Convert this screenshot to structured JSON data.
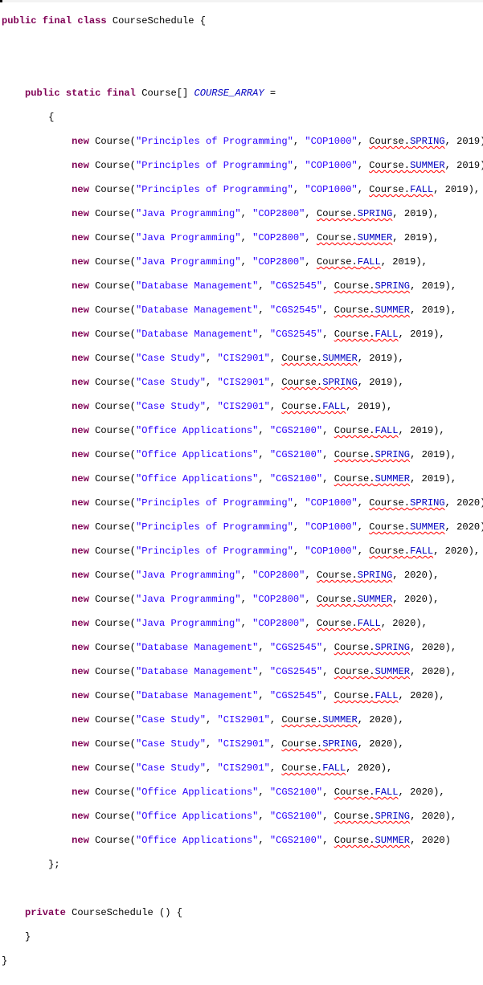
{
  "editor": {
    "class_decl": {
      "modifiers": "public final class",
      "name": "CourseSchedule",
      "open": " {"
    },
    "field_decl": {
      "modifiers": "public static final",
      "type": " Course[] ",
      "name": "COURSE_ARRAY",
      "assign": " ="
    },
    "array_open": "{",
    "array_close": "};",
    "new_keyword": "new",
    "ctor_name": " Course(",
    "enum_prefix": "Course.",
    "courses": [
      {
        "title": "\"Principles of Programming\"",
        "code": "\"COP1000\"",
        "term": "SPRING",
        "year": "2019",
        "tail": "),"
      },
      {
        "title": "\"Principles of Programming\"",
        "code": "\"COP1000\"",
        "term": "SUMMER",
        "year": "2019",
        "tail": "),"
      },
      {
        "title": "\"Principles of Programming\"",
        "code": "\"COP1000\"",
        "term": "FALL",
        "year": "2019",
        "tail": "),"
      },
      {
        "title": "\"Java Programming\"",
        "code": "\"COP2800\"",
        "term": "SPRING",
        "year": "2019",
        "tail": "),"
      },
      {
        "title": "\"Java Programming\"",
        "code": "\"COP2800\"",
        "term": "SUMMER",
        "year": "2019",
        "tail": "),"
      },
      {
        "title": "\"Java Programming\"",
        "code": "\"COP2800\"",
        "term": "FALL",
        "year": "2019",
        "tail": "),"
      },
      {
        "title": "\"Database Management\"",
        "code": "\"CGS2545\"",
        "term": "SPRING",
        "year": "2019",
        "tail": "),"
      },
      {
        "title": "\"Database Management\"",
        "code": "\"CGS2545\"",
        "term": "SUMMER",
        "year": "2019",
        "tail": "),"
      },
      {
        "title": "\"Database Management\"",
        "code": "\"CGS2545\"",
        "term": "FALL",
        "year": "2019",
        "tail": "),"
      },
      {
        "title": "\"Case Study\"",
        "code": "\"CIS2901\"",
        "term": "SUMMER",
        "year": "2019",
        "tail": "),"
      },
      {
        "title": "\"Case Study\"",
        "code": "\"CIS2901\"",
        "term": "SPRING",
        "year": "2019",
        "tail": "),"
      },
      {
        "title": "\"Case Study\"",
        "code": "\"CIS2901\"",
        "term": "FALL",
        "year": "2019",
        "tail": "),"
      },
      {
        "title": "\"Office Applications\"",
        "code": "\"CGS2100\"",
        "term": "FALL",
        "year": "2019",
        "tail": "),"
      },
      {
        "title": "\"Office Applications\"",
        "code": "\"CGS2100\"",
        "term": "SPRING",
        "year": "2019",
        "tail": "),"
      },
      {
        "title": "\"Office Applications\"",
        "code": "\"CGS2100\"",
        "term": "SUMMER",
        "year": "2019",
        "tail": "),"
      },
      {
        "title": "\"Principles of Programming\"",
        "code": "\"COP1000\"",
        "term": "SPRING",
        "year": "2020",
        "tail": "),"
      },
      {
        "title": "\"Principles of Programming\"",
        "code": "\"COP1000\"",
        "term": "SUMMER",
        "year": "2020",
        "tail": "),"
      },
      {
        "title": "\"Principles of Programming\"",
        "code": "\"COP1000\"",
        "term": "FALL",
        "year": "2020",
        "tail": "),"
      },
      {
        "title": "\"Java Programming\"",
        "code": "\"COP2800\"",
        "term": "SPRING",
        "year": "2020",
        "tail": "),"
      },
      {
        "title": "\"Java Programming\"",
        "code": "\"COP2800\"",
        "term": "SUMMER",
        "year": "2020",
        "tail": "),"
      },
      {
        "title": "\"Java Programming\"",
        "code": "\"COP2800\"",
        "term": "FALL",
        "year": "2020",
        "tail": "),"
      },
      {
        "title": "\"Database Management\"",
        "code": "\"CGS2545\"",
        "term": "SPRING",
        "year": "2020",
        "tail": "),"
      },
      {
        "title": "\"Database Management\"",
        "code": "\"CGS2545\"",
        "term": "SUMMER",
        "year": "2020",
        "tail": "),"
      },
      {
        "title": "\"Database Management\"",
        "code": "\"CGS2545\"",
        "term": "FALL",
        "year": "2020",
        "tail": "),"
      },
      {
        "title": "\"Case Study\"",
        "code": "\"CIS2901\"",
        "term": "SUMMER",
        "year": "2020",
        "tail": "),"
      },
      {
        "title": "\"Case Study\"",
        "code": "\"CIS2901\"",
        "term": "SPRING",
        "year": "2020",
        "tail": "),"
      },
      {
        "title": "\"Case Study\"",
        "code": "\"CIS2901\"",
        "term": "FALL",
        "year": "2020",
        "tail": "),"
      },
      {
        "title": "\"Office Applications\"",
        "code": "\"CGS2100\"",
        "term": "FALL",
        "year": "2020",
        "tail": "),"
      },
      {
        "title": "\"Office Applications\"",
        "code": "\"CGS2100\"",
        "term": "SPRING",
        "year": "2020",
        "tail": "),"
      },
      {
        "title": "\"Office Applications\"",
        "code": "\"CGS2100\"",
        "term": "SUMMER",
        "year": "2020",
        "tail": ")"
      }
    ],
    "ctor_decl": {
      "modifier": "private",
      "rest": " CourseSchedule () {"
    },
    "ctor_close": "}",
    "class_close": "}"
  }
}
